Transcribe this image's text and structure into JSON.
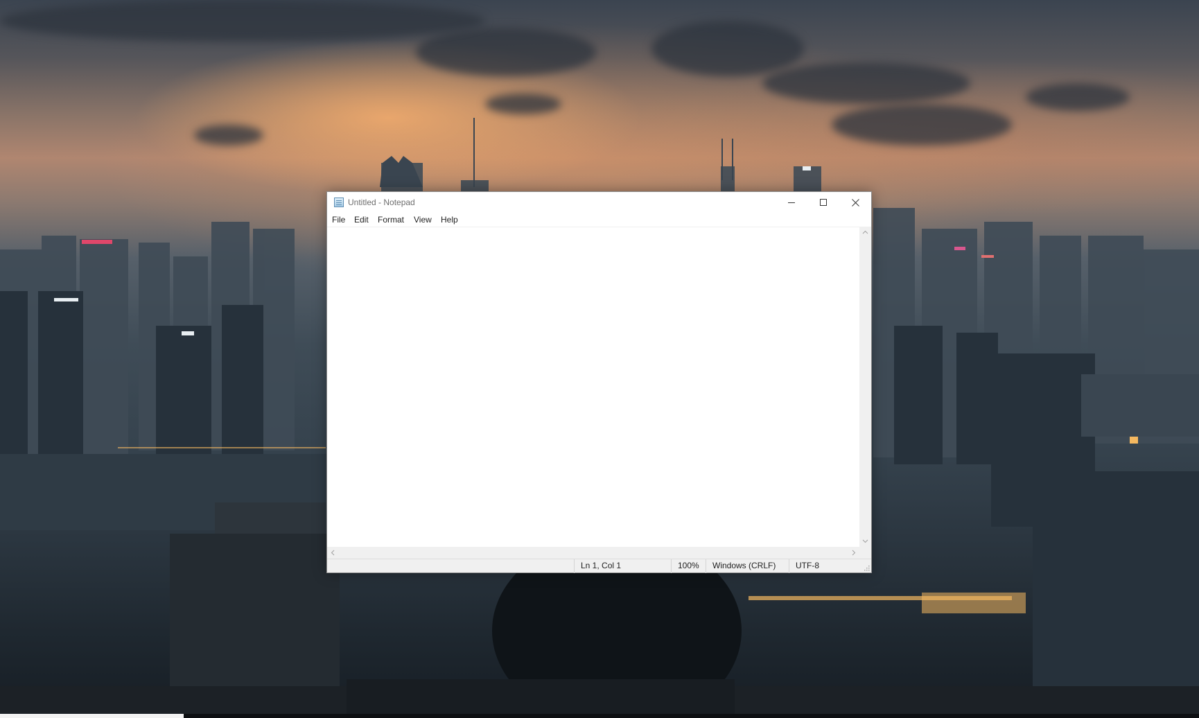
{
  "window": {
    "title": "Untitled - Notepad",
    "app_icon": "notepad-icon"
  },
  "caption_buttons": {
    "minimize_icon": "minimize-icon",
    "maximize_icon": "maximize-icon",
    "close_icon": "close-icon"
  },
  "menu": {
    "items": [
      "File",
      "Edit",
      "Format",
      "View",
      "Help"
    ]
  },
  "editor": {
    "content": ""
  },
  "status_bar": {
    "position": "Ln 1, Col 1",
    "zoom": "100%",
    "line_ending": "Windows (CRLF)",
    "encoding": "UTF-8"
  },
  "colors": {
    "window_bg": "#ffffff",
    "chrome_bg": "#f0f0f0",
    "text": "#1e1e1e",
    "title_text": "#6d6d6d"
  }
}
